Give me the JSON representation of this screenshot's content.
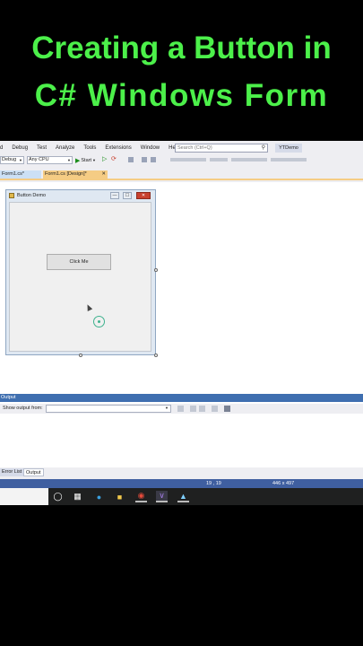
{
  "headline": {
    "line1": "Creating a Button in",
    "line2": "C# Windows Form"
  },
  "colors": {
    "headline": "#4cf04a",
    "status_bar": "#3f5fa0",
    "output_header": "#3f6fb0",
    "active_tab": "#f5cc84"
  },
  "vs": {
    "menu": [
      "d",
      "Debug",
      "Test",
      "Analyze",
      "Tools",
      "Extensions",
      "Window",
      "Help"
    ],
    "search": {
      "placeholder": "Search (Ctrl+Q)",
      "icon": "search-icon"
    },
    "project_name": "YTDemo",
    "toolbar": {
      "config": "Debug",
      "platform": "Any CPU",
      "start_label": "Start"
    },
    "tabs": {
      "code": "Form1.cs*",
      "design": "Form1.cs [Design]*",
      "close": "✕"
    },
    "form": {
      "title": "Button Demo",
      "button_label": "Click Me",
      "min": "—",
      "max": "☐",
      "close": "✕"
    },
    "output": {
      "header": "Output",
      "show_from_label": "Show output from:",
      "selected": ""
    },
    "bottom_tabs": {
      "errors": "Error List",
      "output": "Output"
    },
    "status": {
      "position": "19 , 19",
      "size": "446 x 497"
    }
  },
  "taskbar": {
    "icons": [
      "start-icon",
      "task-view-icon",
      "edge-icon",
      "file-explorer-icon",
      "chrome-icon",
      "visual-studio-icon",
      "installer-icon"
    ]
  }
}
